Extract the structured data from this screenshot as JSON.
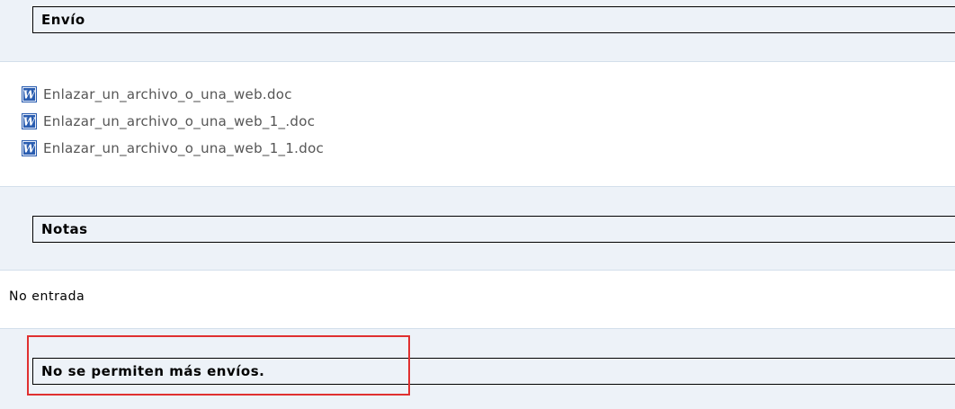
{
  "sections": {
    "envio": {
      "title": "Envío"
    },
    "notas": {
      "title": "Notas",
      "text": "No entrada"
    },
    "status": {
      "title": "No se permiten más envíos."
    }
  },
  "files": [
    {
      "name": "Enlazar_un_archivo_o_una_web.doc",
      "icon": "word-doc-icon"
    },
    {
      "name": "Enlazar_un_archivo_o_una_web_1_.doc",
      "icon": "word-doc-icon"
    },
    {
      "name": "Enlazar_un_archivo_o_una_web_1_1.doc",
      "icon": "word-doc-icon"
    }
  ],
  "colors": {
    "band_background": "#edf2f8",
    "band_border": "#d3dfeb",
    "highlight_box": "#e03030",
    "word_icon_blue": "#2a5db0"
  }
}
